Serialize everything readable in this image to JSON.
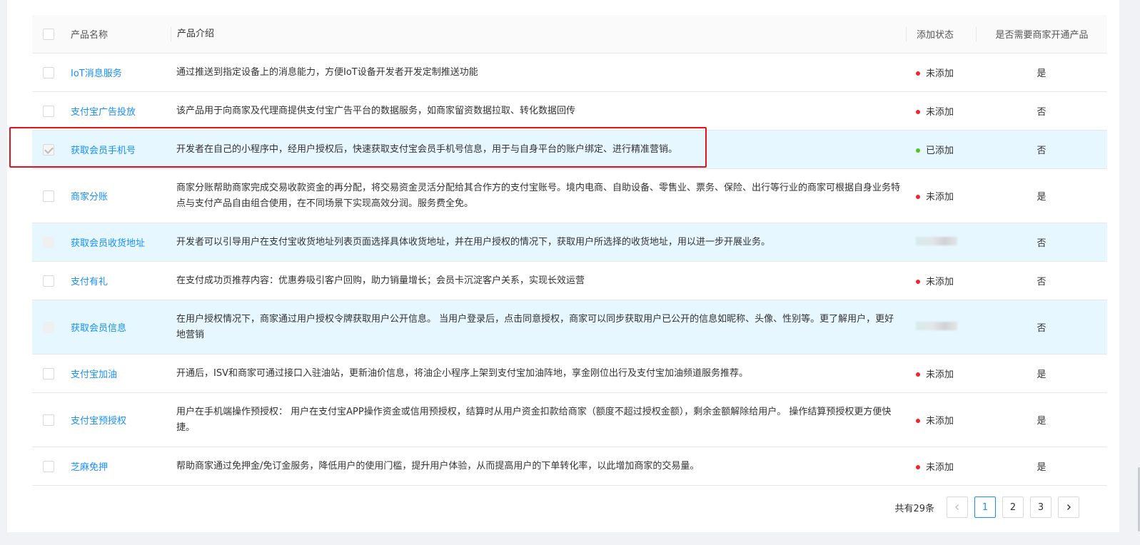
{
  "table": {
    "headers": {
      "name": "产品名称",
      "desc": "产品介绍",
      "status": "添加状态",
      "open": "是否需要商家开通产品"
    },
    "rows": [
      {
        "name": "IoT消息服务",
        "desc": "通过推送到指定设备上的消息能力，方便IoT设备开发者开发定制推送功能",
        "status": "未添加",
        "open": "是"
      },
      {
        "name": "支付宝广告投放",
        "desc": "该产品用于向商家及代理商提供支付宝广告平台的数据服务，如商家留资数据拉取、转化数据回传",
        "status": "未添加",
        "open": "否"
      },
      {
        "name": "获取会员手机号",
        "desc": "开发者在自己的小程序中，经用户授权后，快速获取支付宝会员手机号信息，用于与自身平台的账户绑定、进行精准营销。",
        "status": "已添加",
        "open": "否"
      },
      {
        "name": "商家分账",
        "desc": "商家分账帮助商家完成交易收款资金的再分配，将交易资金灵活分配给其合作方的支付宝账号。境内电商、自助设备、零售业、票务、保险、出行等行业的商家可根据自身业务特点与支付产品自由组合使用，在不同场景下实现高效分润。服务费全免。",
        "status": "未添加",
        "open": "是"
      },
      {
        "name": "获取会员收货地址",
        "desc": "开发者可以引导用户在支付宝收货地址列表页面选择具体收货地址，并在用户授权的情况下，获取用户所选择的收货地址，用以进一步开展业务。",
        "status": "",
        "open": "否"
      },
      {
        "name": "支付有礼",
        "desc": "在支付成功页推荐内容：优惠券吸引客户回购，助力销量增长；会员卡沉淀客户关系，实现长效运营",
        "status": "未添加",
        "open": "否"
      },
      {
        "name": "获取会员信息",
        "desc": "在用户授权情况下，商家通过用户授权令牌获取用户公开信息。 当用户登录后，点击同意授权，商家可以同步获取用户已公开的信息如昵称、头像、性别等。更了解用户，更好地营销",
        "status": "",
        "open": "否"
      },
      {
        "name": "支付宝加油",
        "desc": "开通后，ISV和商家可通过接口入驻油站，更新油价信息，将油企小程序上架到支付宝加油阵地，享金刚位出行及支付宝加油频道服务推荐。",
        "status": "未添加",
        "open": "是"
      },
      {
        "name": "支付宝预授权",
        "desc": "用户在手机端操作预授权： 用户在支付宝APP操作资金或信用预授权，结算时从用户资金扣款给商家（额度不超过授权金额），剩余金额解除给用户。 操作结算预授权更方便快捷。",
        "status": "未添加",
        "open": "是"
      },
      {
        "name": "芝麻免押",
        "desc": "帮助商家通过免押金/免订金服务，降低用户的使用门槛，提升用户体验，从而提高用户的下单转化率，以此增加商家的交易量。",
        "status": "未添加",
        "open": "是"
      }
    ]
  },
  "pagination": {
    "total": "共有29条",
    "pages": [
      "1",
      "2",
      "3"
    ],
    "current": "1",
    "prev_icon": "chevron-left-icon",
    "next_icon": "chevron-right-icon"
  },
  "colors": {
    "link": "#1890ff",
    "not_added_dot": "#f5222d",
    "added_dot": "#52c41a",
    "selected_row": "#e6f7ff",
    "highlight_border": "#e8121c"
  }
}
